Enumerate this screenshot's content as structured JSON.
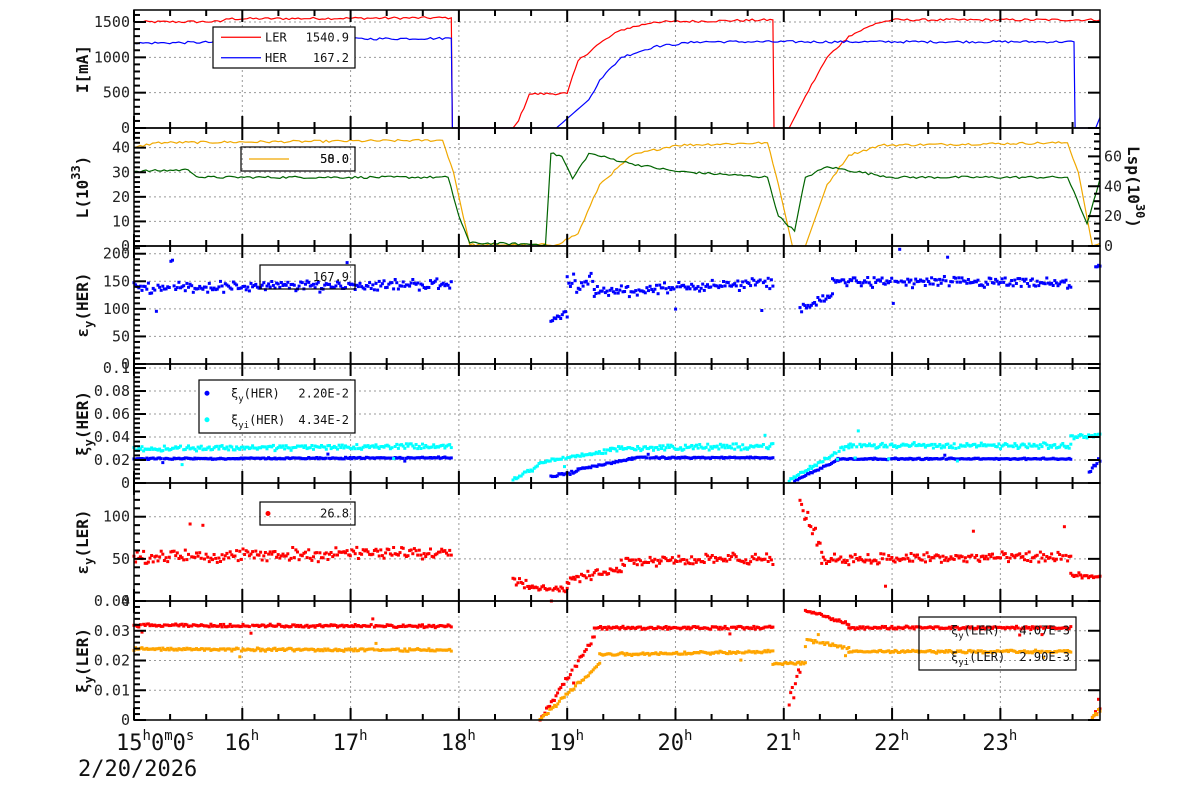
{
  "chart_data": {
    "type": "line",
    "x_axis": {
      "unit": "hour",
      "range": [
        15,
        23.92
      ],
      "tick_labels": [
        {
          "h": 15,
          "parts": [
            "15",
            "h",
            "0",
            "m",
            "0",
            "s"
          ]
        },
        {
          "h": 16,
          "parts": [
            "16",
            "h"
          ]
        },
        {
          "h": 17,
          "parts": [
            "17",
            "h"
          ]
        },
        {
          "h": 18,
          "parts": [
            "18",
            "h"
          ]
        },
        {
          "h": 19,
          "parts": [
            "19",
            "h"
          ]
        },
        {
          "h": 20,
          "parts": [
            "20",
            "h"
          ]
        },
        {
          "h": 21,
          "parts": [
            "21",
            "h"
          ]
        },
        {
          "h": 22,
          "parts": [
            "22",
            "h"
          ]
        },
        {
          "h": 23,
          "parts": [
            "23",
            "h"
          ]
        }
      ],
      "date": "2/20/2026",
      "grid": true
    },
    "panels": [
      {
        "ylabel": {
          "main": "I[mA]",
          "sub": "",
          "sup": "",
          "rest": ""
        },
        "ylim": [
          0,
          1670
        ],
        "yticks": [
          0,
          500,
          1000,
          1500
        ],
        "legend": [
          {
            "name": "LER",
            "value": "1540.9",
            "color": "#ff0000",
            "style": "line"
          },
          {
            "name": "HER",
            "value": "167.2",
            "color": "#0000ff",
            "style": "line"
          }
        ],
        "series": [
          {
            "name": "LER",
            "kind": "line",
            "color": "#ff0000",
            "points": [
              [
                15,
                1500
              ],
              [
                15.8,
                1505
              ],
              [
                15.85,
                1545
              ],
              [
                17.93,
                1560
              ],
              [
                17.94,
                0
              ],
              [
                18.5,
                0
              ],
              [
                18.55,
                100
              ],
              [
                18.65,
                480
              ],
              [
                19.0,
                490
              ],
              [
                19.1,
                950
              ],
              [
                19.3,
                1200
              ],
              [
                19.5,
                1390
              ],
              [
                19.8,
                1500
              ],
              [
                20.9,
                1530
              ],
              [
                20.91,
                0
              ],
              [
                21.05,
                0
              ],
              [
                21.2,
                450
              ],
              [
                21.4,
                1000
              ],
              [
                21.6,
                1300
              ],
              [
                21.85,
                1480
              ],
              [
                22.0,
                1530
              ],
              [
                23.92,
                1530
              ]
            ]
          },
          {
            "name": "HER",
            "kind": "line",
            "color": "#0000ff",
            "points": [
              [
                15,
                1200
              ],
              [
                15.8,
                1215
              ],
              [
                16.0,
                1250
              ],
              [
                17.93,
                1270
              ],
              [
                17.94,
                0
              ],
              [
                18.9,
                0
              ],
              [
                19.2,
                400
              ],
              [
                19.3,
                680
              ],
              [
                19.5,
                1000
              ],
              [
                19.8,
                1150
              ],
              [
                20.2,
                1220
              ],
              [
                23.68,
                1220
              ],
              [
                23.69,
                0
              ],
              [
                23.88,
                0
              ],
              [
                23.92,
                150
              ]
            ]
          }
        ]
      },
      {
        "ylabel": {
          "main": "L(10",
          "sub": "",
          "sup": "33",
          "rest": ")"
        },
        "ylim": [
          0,
          48
        ],
        "yticks": [
          0,
          10,
          20,
          30,
          40
        ],
        "right_axis": {
          "label_main": "Lsp(10",
          "label_sup": "30",
          "label_rest": ")",
          "ylim": [
            0,
            79
          ],
          "yticks": [
            0,
            20,
            40,
            60
          ]
        },
        "legend": [
          {
            "name": "",
            "value": "50.0",
            "color": "#f0a800",
            "style": "line"
          },
          {
            "name": "",
            "value": "58.0",
            "color": "#006400",
            "style": "none"
          }
        ],
        "series": [
          {
            "name": "L",
            "kind": "line",
            "axis": "left",
            "color": "#f0a800",
            "points": [
              [
                15,
                40
              ],
              [
                15.2,
                42
              ],
              [
                17.85,
                43
              ],
              [
                17.95,
                30
              ],
              [
                18.1,
                0.5
              ],
              [
                18.9,
                0.5
              ],
              [
                19.1,
                5
              ],
              [
                19.3,
                25
              ],
              [
                19.6,
                37
              ],
              [
                20.0,
                41
              ],
              [
                20.85,
                42
              ],
              [
                20.95,
                25
              ],
              [
                21.08,
                0
              ],
              [
                21.2,
                0
              ],
              [
                21.4,
                25
              ],
              [
                21.6,
                37
              ],
              [
                21.9,
                41
              ],
              [
                23.62,
                42
              ],
              [
                23.72,
                30
              ],
              [
                23.85,
                0
              ],
              [
                23.92,
                1
              ]
            ]
          },
          {
            "name": "Lsp",
            "kind": "line",
            "axis": "right",
            "color": "#006400",
            "points": [
              [
                15,
                50
              ],
              [
                15.5,
                51
              ],
              [
                15.6,
                46
              ],
              [
                17.9,
                46
              ],
              [
                18.0,
                20
              ],
              [
                18.1,
                2
              ],
              [
                18.8,
                1
              ],
              [
                18.85,
                62
              ],
              [
                18.95,
                60
              ],
              [
                19.05,
                45
              ],
              [
                19.2,
                62
              ],
              [
                19.6,
                55
              ],
              [
                20.0,
                50
              ],
              [
                20.85,
                46
              ],
              [
                20.95,
                20
              ],
              [
                21.1,
                10
              ],
              [
                21.2,
                46
              ],
              [
                21.4,
                53
              ],
              [
                22.0,
                46
              ],
              [
                23.62,
                46
              ],
              [
                23.8,
                15
              ],
              [
                23.92,
                45
              ]
            ]
          }
        ]
      },
      {
        "ylabel": {
          "main": "ε",
          "sub": "y",
          "sup": "",
          "rest": "(HER)"
        },
        "ylim": [
          0,
          214
        ],
        "yticks": [
          0,
          50,
          100,
          150,
          200
        ],
        "legend": [
          {
            "name": "",
            "value": "167.9",
            "color": "#0000ff",
            "style": "none"
          }
        ],
        "series": [
          {
            "name": "εy(HER)",
            "kind": "scatter",
            "color": "#0000ff",
            "segments": [
              [
                15,
                17.93,
                138,
                145,
                12
              ],
              [
                18.85,
                19.0,
                82,
                90,
                8
              ],
              [
                19.0,
                19.25,
                150,
                145,
                25
              ],
              [
                19.25,
                20.9,
                130,
                148,
                12
              ],
              [
                21.15,
                21.45,
                100,
                125,
                8
              ],
              [
                21.45,
                23.65,
                150,
                145,
                12
              ],
              [
                23.88,
                23.92,
                180,
                180,
                15
              ]
            ]
          }
        ]
      },
      {
        "ylabel": {
          "main": "ξ",
          "sub": "y",
          "sup": "",
          "rest": "(HER)"
        },
        "ylim": [
          0,
          0.1035
        ],
        "yticks": [
          0,
          0.02,
          0.04,
          0.06,
          0.08,
          0.1
        ],
        "legend": [
          {
            "name": "ξ",
            "sub": "y",
            "rest": "(HER)",
            "value": "2.20E-2",
            "color": "#0000ff",
            "style": "dot"
          },
          {
            "name": "ξ",
            "sub": "yi",
            "rest": "(HER)",
            "value": "4.34E-2",
            "color": "#00ffff",
            "style": "dot"
          }
        ],
        "series": [
          {
            "name": "ξy(HER)",
            "kind": "scatter",
            "color": "#0000ff",
            "segments": [
              [
                15,
                17.93,
                0.021,
                0.022,
                0.0008
              ],
              [
                18.85,
                19.1,
                0.006,
                0.01,
                0.002
              ],
              [
                19.1,
                19.6,
                0.012,
                0.021,
                0.001
              ],
              [
                19.6,
                20.9,
                0.022,
                0.022,
                0.0008
              ],
              [
                21.1,
                21.5,
                0.002,
                0.02,
                0.001
              ],
              [
                21.5,
                23.65,
                0.021,
                0.021,
                0.0008
              ],
              [
                23.82,
                23.92,
                0.01,
                0.02,
                0.003
              ]
            ]
          },
          {
            "name": "ξyi(HER)",
            "kind": "scatter",
            "color": "#00ffff",
            "segments": [
              [
                15,
                17.93,
                0.03,
                0.032,
                0.003
              ],
              [
                18.5,
                18.8,
                0.002,
                0.019,
                0.002
              ],
              [
                18.8,
                19.4,
                0.019,
                0.028,
                0.002
              ],
              [
                19.4,
                20.9,
                0.03,
                0.032,
                0.003
              ],
              [
                21.05,
                21.6,
                0.002,
                0.033,
                0.002
              ],
              [
                21.6,
                23.65,
                0.033,
                0.032,
                0.003
              ],
              [
                23.65,
                23.92,
                0.04,
                0.042,
                0.002
              ]
            ]
          }
        ]
      },
      {
        "ylabel": {
          "main": "ε",
          "sub": "y",
          "sup": "",
          "rest": "(LER)"
        },
        "ylim": [
          0,
          140
        ],
        "yticks": [
          0,
          50,
          100
        ],
        "legend": [
          {
            "name": "",
            "value": "26.8",
            "color": "#ff0000",
            "style": "dot"
          }
        ],
        "series": [
          {
            "name": "εy(LER)",
            "kind": "scatter",
            "color": "#ff0000",
            "segments": [
              [
                15,
                17.93,
                52,
                58,
                9
              ],
              [
                18.5,
                18.65,
                30,
                20,
                10
              ],
              [
                18.65,
                19.0,
                16,
                14,
                4
              ],
              [
                19.0,
                19.5,
                25,
                38,
                6
              ],
              [
                19.5,
                20.9,
                48,
                50,
                8
              ],
              [
                21.15,
                21.35,
                115,
                60,
                12
              ],
              [
                21.35,
                23.65,
                50,
                52,
                8
              ],
              [
                23.65,
                23.92,
                30,
                28,
                5
              ]
            ]
          }
        ]
      },
      {
        "ylabel": {
          "main": "ξ",
          "sub": "y",
          "sup": "",
          "rest": "(LER)"
        },
        "ylim": [
          0,
          0.04
        ],
        "yticks": [
          0,
          0.01,
          0.02,
          0.03,
          0.04
        ],
        "legend": [
          {
            "name": "ξ",
            "sub": "y",
            "rest": "(LER)",
            "value": "4.07E-3",
            "color": "#ff0000",
            "style": "none"
          },
          {
            "name": "ξ",
            "sub": "yi",
            "rest": "(LER)",
            "value": "2.90E-3",
            "color": "#ffa500",
            "style": "none"
          }
        ],
        "series": [
          {
            "name": "ξy(LER)",
            "kind": "scatter",
            "color": "#ff0000",
            "segments": [
              [
                15,
                17.93,
                0.0318,
                0.0315,
                0.0006
              ],
              [
                18.75,
                19.25,
                0.0,
                0.028,
                0.001
              ],
              [
                19.25,
                20.9,
                0.031,
                0.031,
                0.0006
              ],
              [
                21.05,
                21.15,
                0.005,
                0.018,
                0.004
              ],
              [
                21.2,
                21.6,
                0.037,
                0.032,
                0.0008
              ],
              [
                21.6,
                23.65,
                0.031,
                0.031,
                0.0006
              ],
              [
                23.85,
                23.92,
                0.001,
                0.004,
                0.001
              ]
            ]
          },
          {
            "name": "ξyi(LER)",
            "kind": "scatter",
            "color": "#ffa500",
            "segments": [
              [
                15,
                17.93,
                0.0238,
                0.0235,
                0.0006
              ],
              [
                18.75,
                19.3,
                0.0,
                0.019,
                0.001
              ],
              [
                19.3,
                20.9,
                0.022,
                0.023,
                0.0006
              ],
              [
                20.9,
                21.2,
                0.019,
                0.019,
                0.0005
              ],
              [
                21.2,
                21.6,
                0.027,
                0.024,
                0.0006
              ],
              [
                21.6,
                23.65,
                0.023,
                0.023,
                0.0006
              ],
              [
                23.85,
                23.92,
                0.001,
                0.003,
                0.001
              ]
            ]
          }
        ]
      }
    ]
  }
}
